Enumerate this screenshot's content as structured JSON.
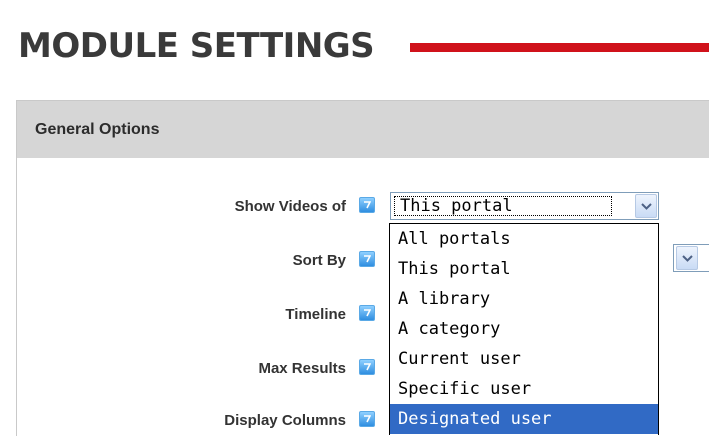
{
  "page": {
    "title": "MODULE SETTINGS"
  },
  "panel": {
    "header": "General Options"
  },
  "rows": [
    {
      "label": "Show Videos of",
      "value": "This portal"
    },
    {
      "label": "Sort By"
    },
    {
      "label": "Timeline"
    },
    {
      "label": "Max Results"
    },
    {
      "label": "Display Columns"
    }
  ],
  "dropdown": {
    "options": [
      "All portals",
      "This portal",
      "A library",
      "A category",
      "Current user",
      "Specific user",
      "Designated user"
    ],
    "highlighted": "Designated user"
  },
  "colors": {
    "accent_bar": "#d0121b",
    "panel_header": "#d6d6d6",
    "highlight": "#316ac5",
    "help_icon": "#2f8ee0"
  },
  "icons": {
    "help": "help-icon",
    "dropdown": "chevron-down-icon"
  }
}
